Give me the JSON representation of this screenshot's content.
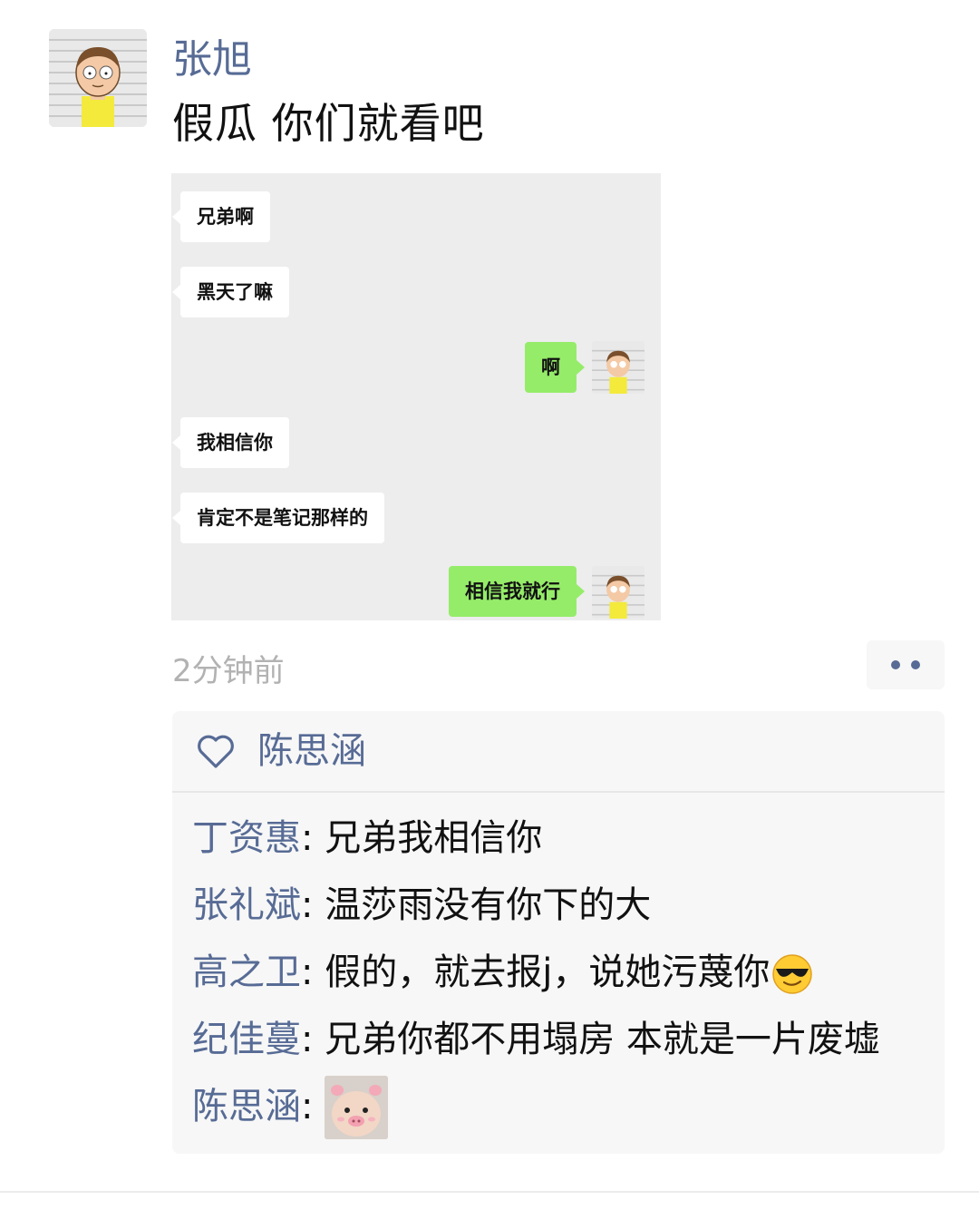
{
  "post": {
    "author": "张旭",
    "text": "假瓜 你们就看吧",
    "time": "2分钟前"
  },
  "screenshot": {
    "messages": [
      {
        "side": "left",
        "text": "兄弟啊"
      },
      {
        "side": "left",
        "text": "黑天了嘛"
      },
      {
        "side": "right",
        "text": "啊"
      },
      {
        "side": "left",
        "text": "我相信你"
      },
      {
        "side": "left",
        "text": "肯定不是笔记那样的"
      },
      {
        "side": "right",
        "text": "相信我就行"
      }
    ]
  },
  "interactions": {
    "like_icon": "heart-outline-icon",
    "likes": "陈思涵",
    "comments": [
      {
        "name": "丁资惠",
        "sep": ": ",
        "text": "兄弟我相信你"
      },
      {
        "name": "张礼斌",
        "sep": ": ",
        "text": "温莎雨没有你下的大"
      },
      {
        "name": "高之卫",
        "sep": ": ",
        "text": "假的，就去报j，说她污蔑你",
        "emoji": "sunglasses-smiley-icon"
      },
      {
        "name": "纪佳蔓",
        "sep": ": ",
        "text": "兄弟你都不用塌房 本就是一片废墟"
      },
      {
        "name": "陈思涵",
        "sep": ": ",
        "text": "",
        "sticker": "baby-pig-filter-sticker"
      }
    ]
  },
  "colors": {
    "link_blue": "#576b95",
    "bubble_green": "#95ec69",
    "time_gray": "#b2b2b2"
  }
}
